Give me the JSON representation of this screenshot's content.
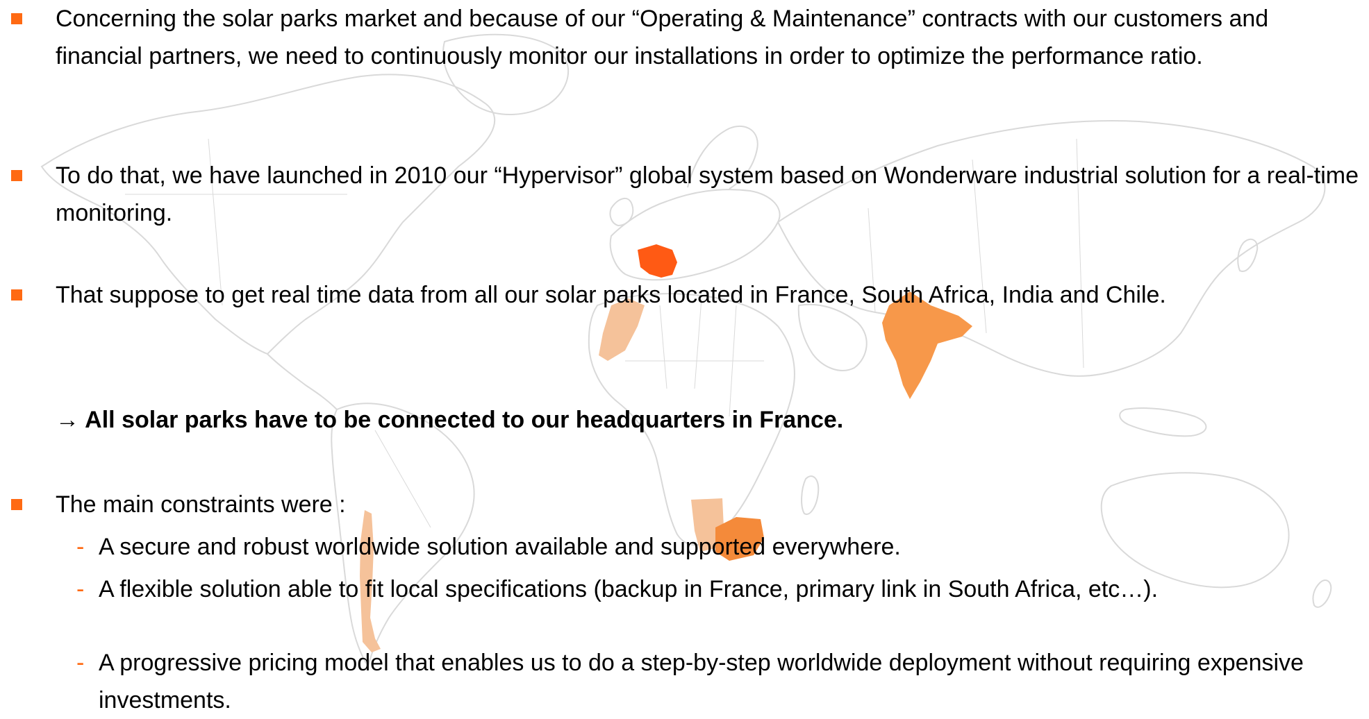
{
  "accent_color": "#ff6a13",
  "map": {
    "highlight_colors": {
      "france": "#ff5a14",
      "india": "#f7984a",
      "south_africa": "#f48a3a",
      "secondary": "#f5c29a"
    },
    "outline_color": "#d9d9d9"
  },
  "bullets": [
    {
      "icon": "square-bullet-icon",
      "text": "Concerning the solar parks market and because of our “Operating & Maintenance” contracts with our customers and financial partners, we need to continuously monitor our installations in order to optimize the performance ratio."
    },
    {
      "icon": "square-bullet-icon",
      "text": "To do that, we have launched in 2010 our “Hypervisor” global system based on Wonderware industrial solution for a real-time monitoring."
    },
    {
      "icon": "square-bullet-icon",
      "text": "That suppose to get real time data from all our solar parks located in France, South Africa, India and Chile."
    },
    {
      "icon": "square-bullet-icon",
      "text": "The main constraints were :"
    }
  ],
  "emphasis": "→ All solar parks have to be connected to our headquarters in France.",
  "constraints": [
    {
      "marker": "-",
      "text": "A secure and robust worldwide solution available and supported everywhere."
    },
    {
      "marker": "-",
      "text": "A flexible solution able to fit local specifications (backup in France, primary link in South Africa, etc…)."
    },
    {
      "marker": "-",
      "text": "A progressive pricing model that enables us to do a step-by-step worldwide deployment without requiring expensive investments."
    }
  ]
}
